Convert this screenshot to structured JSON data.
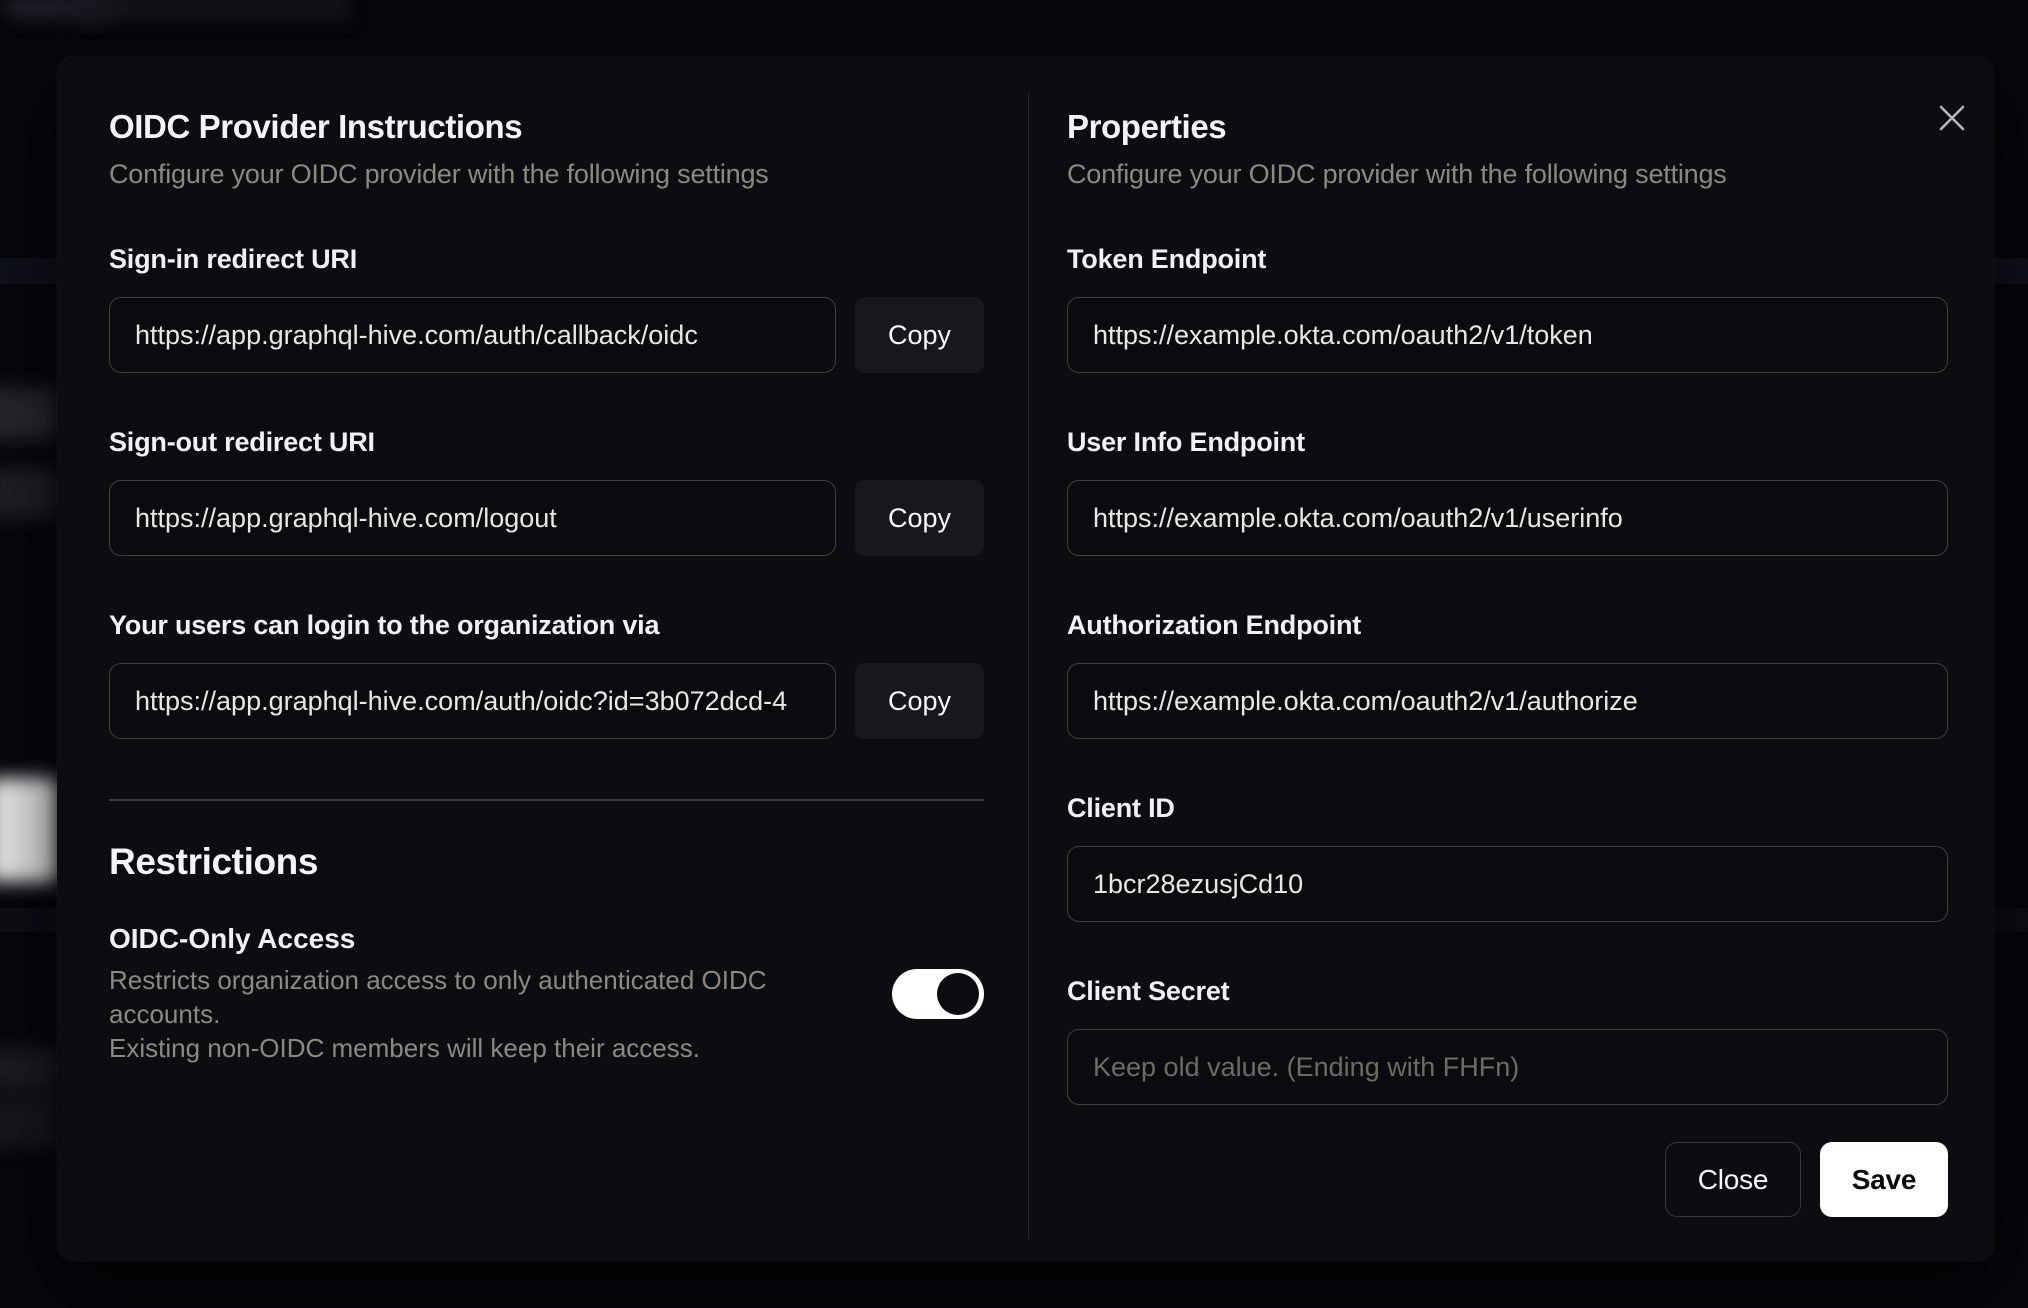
{
  "modal": {
    "left": {
      "title": "OIDC Provider Instructions",
      "subtitle": "Configure your OIDC provider with the following settings",
      "fields": [
        {
          "label": "Sign-in redirect URI",
          "value": "https://app.graphql-hive.com/auth/callback/oidc",
          "button": "Copy"
        },
        {
          "label": "Sign-out redirect URI",
          "value": "https://app.graphql-hive.com/logout",
          "button": "Copy"
        },
        {
          "label": "Your users can login to the organization via",
          "value": "https://app.graphql-hive.com/auth/oidc?id=3b072dcd-4",
          "button": "Copy"
        }
      ],
      "restrictions": {
        "title": "Restrictions",
        "toggle_label": "OIDC-Only Access",
        "toggle_description_line1": "Restricts organization access to only authenticated OIDC accounts.",
        "toggle_description_line2": "Existing non-OIDC members will keep their access.",
        "toggle_state": "on"
      }
    },
    "right": {
      "title": "Properties",
      "subtitle": "Configure your OIDC provider with the following settings",
      "fields": [
        {
          "label": "Token Endpoint",
          "value": "https://example.okta.com/oauth2/v1/token"
        },
        {
          "label": "User Info Endpoint",
          "value": "https://example.okta.com/oauth2/v1/userinfo"
        },
        {
          "label": "Authorization Endpoint",
          "value": "https://example.okta.com/oauth2/v1/authorize"
        },
        {
          "label": "Client ID",
          "value": "1bcr28ezusjCd10"
        },
        {
          "label": "Client Secret",
          "value": "",
          "placeholder": "Keep old value. (Ending with FHFn)"
        }
      ],
      "footer": {
        "close_label": "Close",
        "save_label": "Save"
      }
    },
    "close_icon": "✕"
  },
  "colors": {
    "modal_bg": "#0c0d10",
    "page_bg": "#06070b",
    "input_border": "#443e34",
    "muted_text": "#8d8882",
    "save_bg": "#ffffff",
    "toggle_track": "#ffffff",
    "toggle_knob": "#0b0c10"
  }
}
